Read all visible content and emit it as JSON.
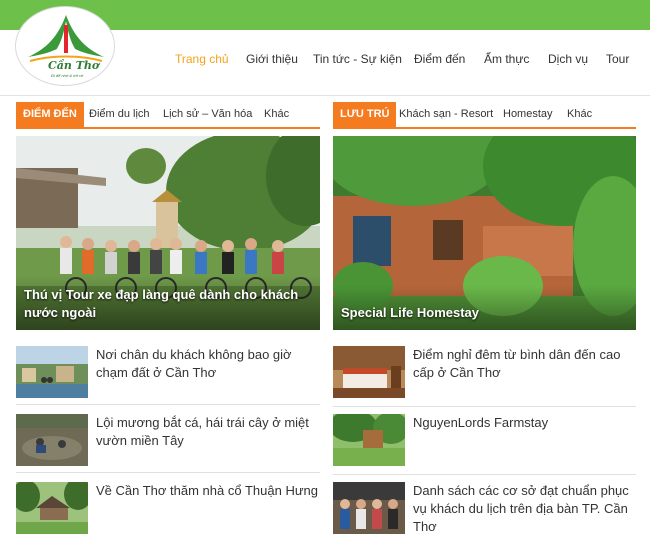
{
  "header": {
    "logo": {
      "name": "Cần Thơ",
      "slogan": "Đi để nhớ & trở về"
    },
    "nav": [
      "Trang chủ",
      "Giới thiệu",
      "Tin tức - Sự kiện",
      "Điểm đến",
      "Ẩm thực",
      "Dịch vụ",
      "Tour"
    ],
    "active_nav": "Trang chủ"
  },
  "left": {
    "tag": "ĐIỂM ĐẾN",
    "links": [
      "Điểm du lịch",
      "Lịch sử – Văn hóa",
      "Khác"
    ],
    "feature": {
      "title": "Thú vị Tour xe đạp làng quê dành cho khách nước ngoài",
      "image": "cycling-group-photo"
    },
    "items": [
      {
        "title": "Nơi chân du khách không bao giờ chạm đất ở Cần Thơ",
        "image": "floating-village-photo"
      },
      {
        "title": "Lội mương bắt cá, hái trái cây ở miệt vườn miền Tây",
        "image": "fishing-ditch-photo"
      },
      {
        "title": "Về Cần Thơ thăm nhà cổ Thuận Hưng",
        "image": "ancient-house-photo"
      }
    ]
  },
  "right": {
    "tag": "LƯU TRÚ",
    "links": [
      "Khách sạn - Resort",
      "Homestay",
      "Khác"
    ],
    "feature": {
      "title": "Special Life Homestay",
      "image": "homestay-garden-photo"
    },
    "items": [
      {
        "title": "Điểm nghỉ đêm từ bình dân đến cao cấp ở Cần Thơ",
        "image": "hotel-room-photo"
      },
      {
        "title": "NguyenLords Farmstay",
        "image": "farmstay-garden-photo"
      },
      {
        "title": "Danh sách các cơ sở đạt chuẩn phục vụ khách du lịch trên địa bàn TP. Cần Thơ",
        "image": "tourist-group-photo"
      }
    ]
  },
  "colors": {
    "topbar": "#6dc14b",
    "accent": "#f47b20",
    "active_nav": "#f5a31a"
  }
}
